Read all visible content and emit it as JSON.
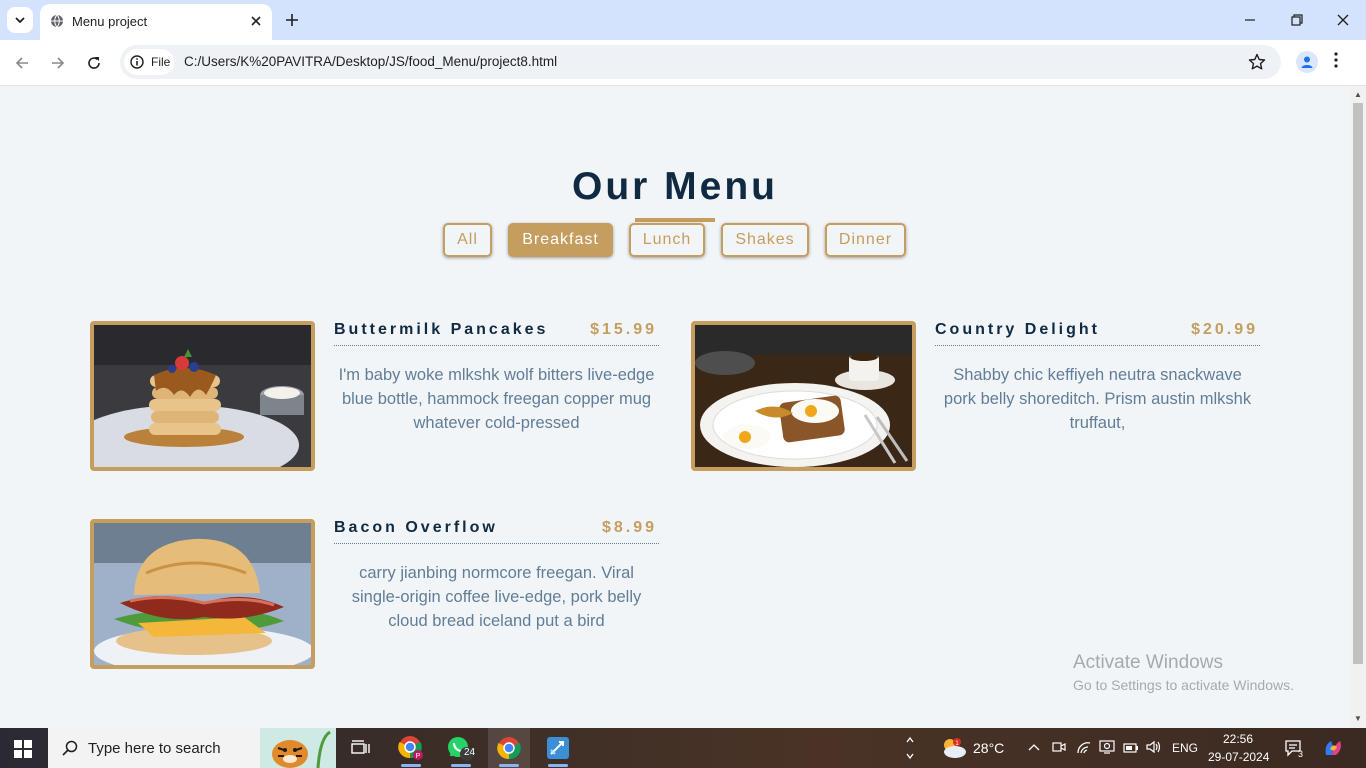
{
  "browser": {
    "tab_title": "Menu project",
    "chip_label": "File",
    "url": "C:/Users/K%20PAVITRA/Desktop/JS/food_Menu/project8.html"
  },
  "page": {
    "title": "Our Menu",
    "filters": [
      "All",
      "Breakfast",
      "Lunch",
      "Shakes",
      "Dinner"
    ],
    "active_filter": "Breakfast",
    "items": [
      {
        "name": "Buttermilk Pancakes",
        "price": "$15.99",
        "desc": "I'm baby woke mlkshk wolf bitters live-edge blue bottle, hammock freegan copper mug whatever cold-pressed",
        "image": "pancake-stack-photo"
      },
      {
        "name": "Country Delight",
        "price": "$20.99",
        "desc": "Shabby chic keffiyeh neutra snackwave pork belly shoreditch. Prism austin mlkshk truffaut,",
        "image": "eggs-toast-photo"
      },
      {
        "name": "Bacon Overflow",
        "price": "$8.99",
        "desc": "carry jianbing normcore freegan. Viral single-origin coffee live-edge, pork belly cloud bread iceland put a bird",
        "image": "bacon-biscuit-photo"
      }
    ],
    "watermark": {
      "line1": "Activate Windows",
      "line2": "Go to Settings to activate Windows."
    }
  },
  "taskbar": {
    "search_placeholder": "Type here to search",
    "whatsapp_badge": "24",
    "weather": "28°C",
    "language": "ENG",
    "time": "22:56",
    "date": "29-07-2024",
    "notification_count": "3"
  },
  "colors": {
    "accent": "#c59d5f",
    "heading": "#102a42",
    "text": "#617d98",
    "background": "#f1f5f8"
  }
}
